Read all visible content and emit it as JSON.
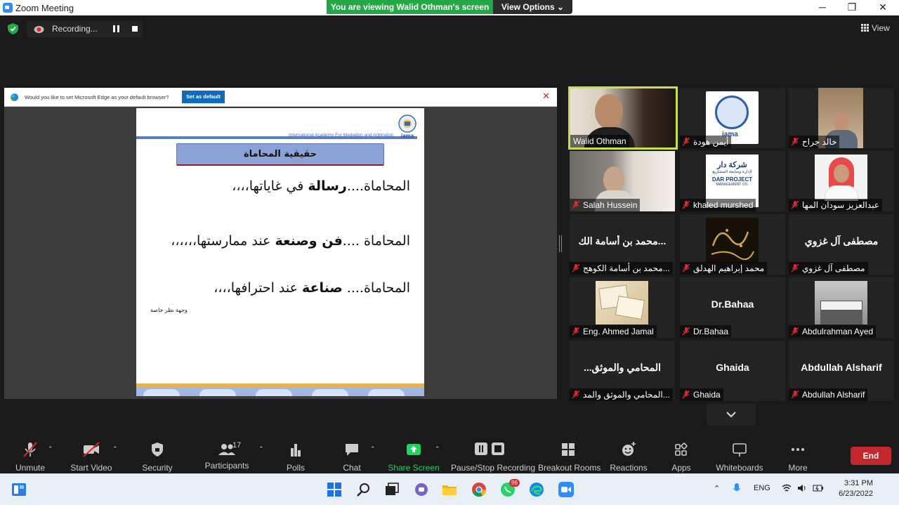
{
  "window": {
    "title": "Zoom Meeting",
    "viewing_banner": "You are viewing Walid Othman's screen",
    "view_options": "View Options",
    "minimize": "─",
    "maximize": "❐",
    "close": "✕"
  },
  "recording": {
    "label": "Recording..."
  },
  "view_button": {
    "label": "View"
  },
  "shared_screen": {
    "edge_prompt": "Would you like to set Microsoft Edge as your default browser?",
    "edge_set_default": "Set as default",
    "slide": {
      "academy": "International Academy For Mediation and Arbitration",
      "logo_text": "iama",
      "title": "حقيقية المحاماة",
      "lines": [
        {
          "pre": "المحاماة....",
          "bold": "رسالة",
          "post": " في غاياتها،،،،"
        },
        {
          "pre": "المحاماة ....",
          "bold": "فن وصنعة",
          "post": " عند ممارستها،،،،،،"
        },
        {
          "pre": "المحاماة.... ",
          "bold": "صناعة",
          "post": " عند احترافها،،،،"
        }
      ],
      "note": "وجهة نظر خاصة"
    }
  },
  "participants_tiles": [
    {
      "name": "Walid Othman",
      "muted": false,
      "active": true,
      "kind": "video"
    },
    {
      "name": "أيمن هودة",
      "muted": true,
      "kind": "logo"
    },
    {
      "name": "خالد جراح",
      "muted": true,
      "kind": "photo"
    },
    {
      "name": "Salah Hussein",
      "muted": true,
      "kind": "video"
    },
    {
      "name": "khaled murshed",
      "muted": true,
      "kind": "dar",
      "logo_line1": "شركة دار",
      "logo_line2": "لإدارة ومتابعة المشاريع",
      "logo_line3": "DAR PROJECT",
      "logo_line4": "MANAGEMENT CO."
    },
    {
      "name": "عبدالعزيز سودان المها",
      "muted": true,
      "kind": "photo2"
    },
    {
      "name": "محمد بن أسامة الكوهج...",
      "muted": true,
      "kind": "text",
      "big": "...محمد بن أسامة الك"
    },
    {
      "name": "محمد إبراهيم الهدلق",
      "muted": true,
      "kind": "callig"
    },
    {
      "name": "مصطفى آل غزوي",
      "muted": true,
      "kind": "text",
      "big": "مصطفى آل غزوي"
    },
    {
      "name": "Eng. Ahmed Jamal",
      "muted": true,
      "kind": "docs"
    },
    {
      "name": "Dr.Bahaa",
      "muted": true,
      "kind": "text",
      "big": "Dr.Bahaa"
    },
    {
      "name": "Abdulrahman Ayed",
      "muted": true,
      "kind": "sign"
    },
    {
      "name": "المحامي والموثق والمد...",
      "muted": true,
      "kind": "text",
      "big": "المحامي والموثق..."
    },
    {
      "name": "Ghaida",
      "muted": true,
      "kind": "text",
      "big": "Ghaida"
    },
    {
      "name": "Abdullah Alsharif",
      "muted": true,
      "kind": "text",
      "big": "Abdullah Alsharif"
    }
  ],
  "toolbar": {
    "unmute": "Unmute",
    "start_video": "Start Video",
    "security": "Security",
    "participants": "Participants",
    "participants_count": "17",
    "polls": "Polls",
    "chat": "Chat",
    "share_screen": "Share Screen",
    "pause_stop_recording": "Pause/Stop Recording",
    "breakout_rooms": "Breakout Rooms",
    "reactions": "Reactions",
    "apps": "Apps",
    "whiteboards": "Whiteboards",
    "more": "More",
    "end": "End"
  },
  "taskbar": {
    "whatsapp_badge": "96",
    "language": "ENG",
    "time": "3:31 PM",
    "date": "6/23/2022"
  },
  "colors": {
    "accent_green": "#23a845",
    "active_speaker": "#c8e04a",
    "end_red": "#c1272d",
    "mute_red": "#e02828"
  }
}
